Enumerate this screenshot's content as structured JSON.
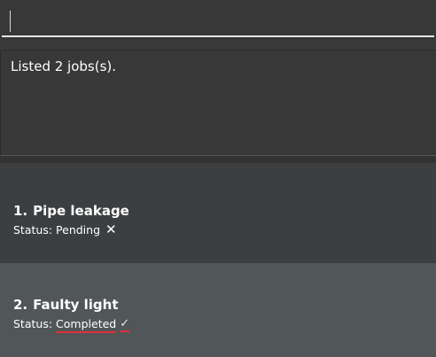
{
  "command_box": {
    "value": ""
  },
  "result_display": {
    "message": "Listed 2 jobs(s)."
  },
  "jobs": [
    {
      "index": "1.",
      "title": "Pipe leakage",
      "status_label": "Status:",
      "status_value": "Pending",
      "status_icon": "cross-icon",
      "status_glyph": "✕"
    },
    {
      "index": "2.",
      "title": "Faulty light",
      "status_label": "Status:",
      "status_value": "Completed",
      "status_icon": "check-icon",
      "status_glyph": "✓"
    }
  ],
  "colors": {
    "background": "#3a3a3a",
    "card_odd": "#3c3f41",
    "card_even": "#515658",
    "text": "#ffffff",
    "spellcheck_underline": "#e0313a"
  }
}
